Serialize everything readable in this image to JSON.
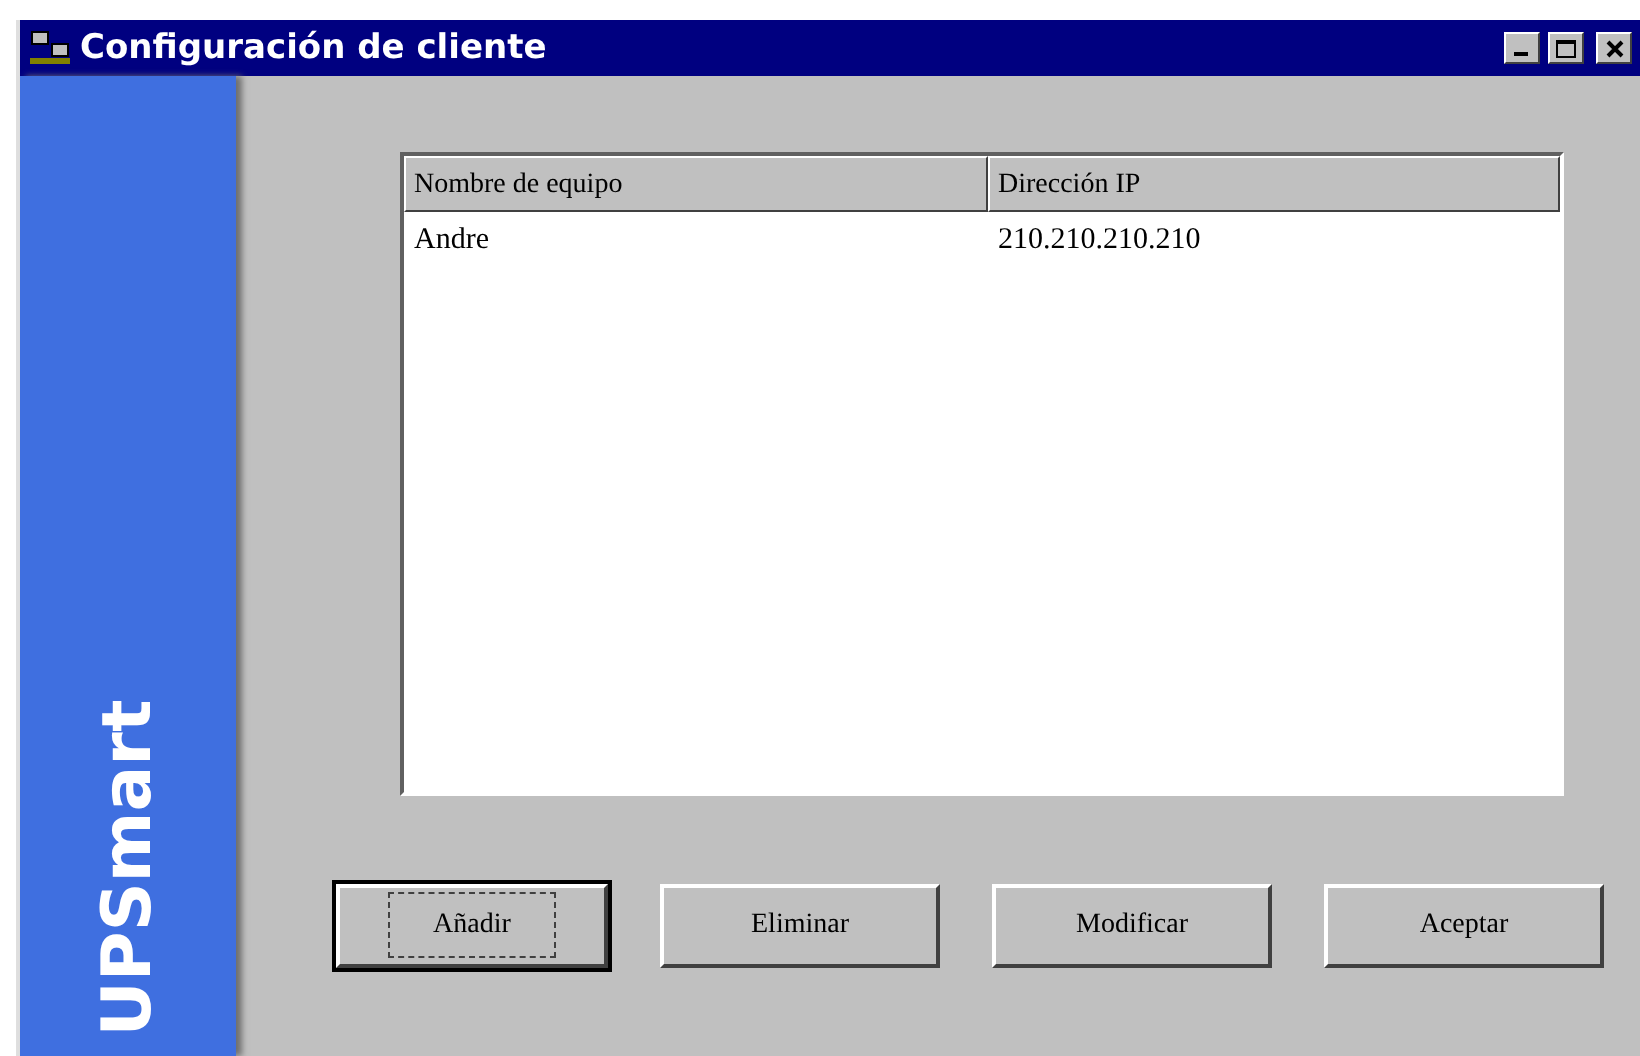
{
  "window": {
    "title": "Configuración de cliente"
  },
  "sidebar": {
    "brand": "UPSmart"
  },
  "table": {
    "columns": [
      "Nombre de equipo",
      "Dirección IP"
    ],
    "rows": [
      {
        "cells": [
          "Andre",
          "210.210.210.210"
        ]
      }
    ]
  },
  "buttons": [
    {
      "label": "Añadir",
      "default": true
    },
    {
      "label": "Eliminar",
      "default": false
    },
    {
      "label": "Modificar",
      "default": false
    },
    {
      "label": "Aceptar",
      "default": false
    }
  ]
}
